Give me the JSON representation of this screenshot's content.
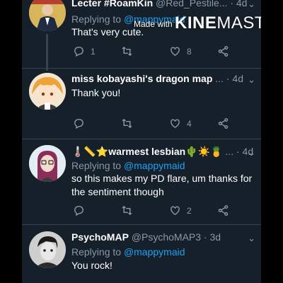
{
  "tweets": [
    {
      "name": "Lecter #RoamKin",
      "handle": "@Red_Pestile...",
      "time": "· 4d",
      "replying_prefix": "Replying to ",
      "replying_to": "@mappymaid",
      "text": "That's very cute.",
      "replies": "1",
      "retweets": "",
      "likes": "8"
    },
    {
      "name": "miss kobayashi's dragon map",
      "handle": "...",
      "time": "· 4d",
      "text": "Thank you!",
      "replies": "",
      "retweets": "",
      "likes": "4"
    },
    {
      "name": "🌡️📏⭐warmest lesbian🌵☀️🍍",
      "handle": "...",
      "time": "· 4d",
      "replying_prefix": "Replying to ",
      "replying_to": "@mappymaid",
      "text": "so this makes my PD flare, um thanks for the sentiment though",
      "replies": "",
      "retweets": "",
      "likes": "2"
    },
    {
      "name": "PsychoMAP",
      "handle": "@PsychoMAP3",
      "time": "· 3d",
      "replying_prefix": "Replying to ",
      "replying_to": "@mappymaid",
      "text": "You rock!",
      "replies": "",
      "retweets": "",
      "likes": ""
    }
  ],
  "watermark": {
    "prefix": "Made with ",
    "brand_bold": "KINE",
    "brand_rest": "MASTER"
  },
  "icons": {
    "reply": "reply-icon",
    "retweet": "retweet-icon",
    "like": "heart-icon",
    "share": "share-icon",
    "more": "chevron-down-icon"
  },
  "colors": {
    "background": "#15202b",
    "secondary_text": "#8899a6",
    "link": "#1da1f2",
    "divider": "#38444d"
  }
}
